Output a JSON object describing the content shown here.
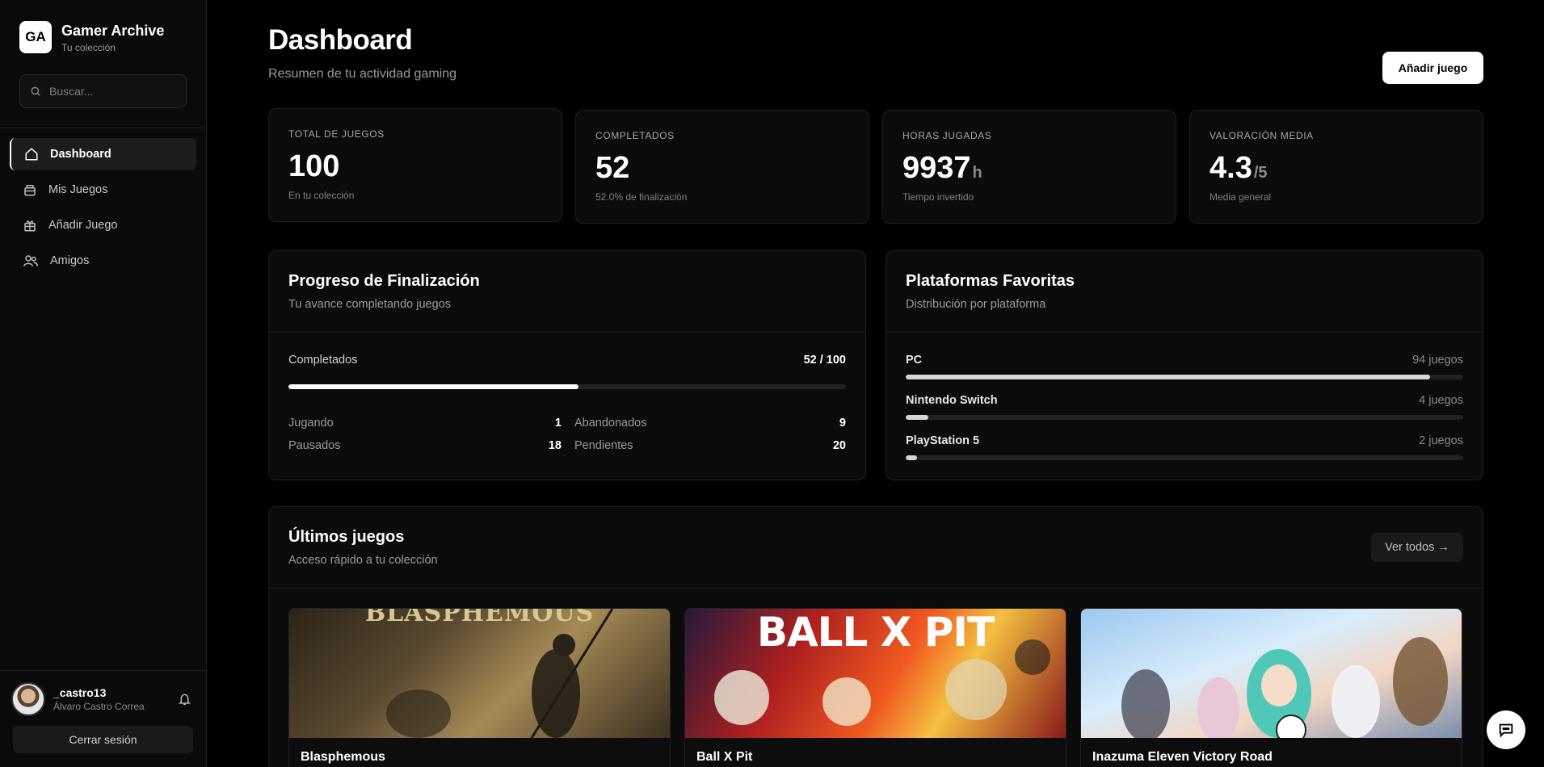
{
  "brand": {
    "logo": "GA",
    "title": "Gamer Archive",
    "subtitle": "Tu colección"
  },
  "search": {
    "placeholder": "Buscar..."
  },
  "nav": [
    {
      "label": "Dashboard",
      "icon": "home-icon",
      "active": true
    },
    {
      "label": "Mis Juegos",
      "icon": "games-icon"
    },
    {
      "label": "Añadir Juego",
      "icon": "gift-icon"
    },
    {
      "label": "Amigos",
      "icon": "users-icon"
    }
  ],
  "user": {
    "username": "_castro13",
    "fullname": "Álvaro Castro Correa"
  },
  "logout_label": "Cerrar sesión",
  "header": {
    "title": "Dashboard",
    "subtitle": "Resumen de tu actividad gaming",
    "add_label": "Añadir juego"
  },
  "stats": [
    {
      "label": "TOTAL DE JUEGOS",
      "value": "100",
      "unit": "",
      "sub": "En tu colección"
    },
    {
      "label": "COMPLETADOS",
      "value": "52",
      "unit": "",
      "sub": "52.0% de finalización"
    },
    {
      "label": "HORAS JUGADAS",
      "value": "9937",
      "unit": "h",
      "sub": "Tiempo invertido"
    },
    {
      "label": "VALORACIÓN MEDIA",
      "value": "4.3",
      "unit": "/5",
      "sub": "Media general"
    }
  ],
  "progress": {
    "title": "Progreso de Finalización",
    "subtitle": "Tu avance completando juegos",
    "completed_label": "Completados",
    "completed_value": "52 / 100",
    "completed_fraction": 0.52,
    "rows": [
      {
        "label": "Jugando",
        "value": "1"
      },
      {
        "label": "Abandonados",
        "value": "9"
      },
      {
        "label": "Pausados",
        "value": "18"
      },
      {
        "label": "Pendientes",
        "value": "20"
      }
    ]
  },
  "platforms": {
    "title": "Plataformas Favoritas",
    "subtitle": "Distribución por plataforma",
    "items": [
      {
        "name": "PC",
        "count": "94 juegos",
        "fraction": 0.94
      },
      {
        "name": "Nintendo Switch",
        "count": "4 juegos",
        "fraction": 0.04
      },
      {
        "name": "PlayStation 5",
        "count": "2 juegos",
        "fraction": 0.02
      }
    ]
  },
  "latest": {
    "title": "Últimos juegos",
    "subtitle": "Acceso rápido a tu colección",
    "view_all": "Ver todos →",
    "games": [
      {
        "title": "Blasphemous",
        "art_text": "BLASPHEMOUS"
      },
      {
        "title": "Ball X Pit",
        "art_text": "BALL X PIT"
      },
      {
        "title": "Inazuma Eleven Victory Road",
        "art_text": ""
      }
    ]
  }
}
